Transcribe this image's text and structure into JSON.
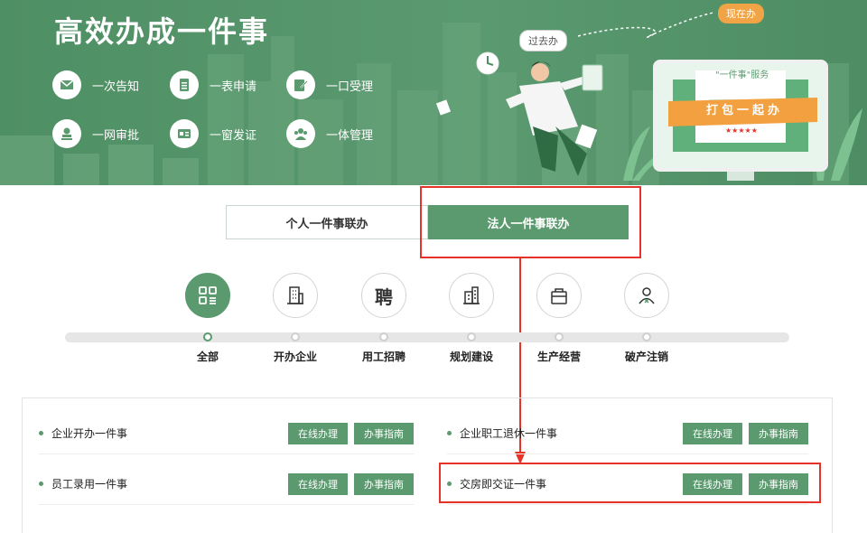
{
  "banner": {
    "title": "高效办成一件事",
    "features": [
      {
        "label": "一次告知",
        "icon": "envelope-icon"
      },
      {
        "label": "一表申请",
        "icon": "form-icon"
      },
      {
        "label": "一口受理",
        "icon": "edit-icon"
      },
      {
        "label": "一网审批",
        "icon": "stamp-icon"
      },
      {
        "label": "一窗发证",
        "icon": "card-icon"
      },
      {
        "label": "一体管理",
        "icon": "people-icon"
      }
    ],
    "past_label": "过去办",
    "now_label": "现在办",
    "service_tag": "\"一件事\"服务",
    "ribbon": "打包一起办",
    "stars": "★★★★★"
  },
  "tabs": [
    {
      "label": "个人一件事联办",
      "active": false
    },
    {
      "label": "法人一件事联办",
      "active": true
    }
  ],
  "categories": [
    {
      "label": "全部",
      "icon": "grid-icon",
      "active": true
    },
    {
      "label": "开办企业",
      "icon": "building-icon",
      "active": false
    },
    {
      "label": "用工招聘",
      "icon": "hire-icon",
      "active": false
    },
    {
      "label": "规划建设",
      "icon": "construction-icon",
      "active": false
    },
    {
      "label": "生产经营",
      "icon": "bag-icon",
      "active": false
    },
    {
      "label": "破产注销",
      "icon": "person-cancel-icon",
      "active": false
    }
  ],
  "items": [
    {
      "title": "企业开办一件事",
      "online": "在线办理",
      "guide": "办事指南"
    },
    {
      "title": "企业职工退休一件事",
      "online": "在线办理",
      "guide": "办事指南"
    },
    {
      "title": "员工录用一件事",
      "online": "在线办理",
      "guide": "办事指南"
    },
    {
      "title": "交房即交证一件事",
      "online": "在线办理",
      "guide": "办事指南"
    }
  ],
  "colors": {
    "primary": "#5a9a6e",
    "banner": "#4f8f64",
    "highlight": "#e5332a",
    "accent": "#f0a445"
  }
}
